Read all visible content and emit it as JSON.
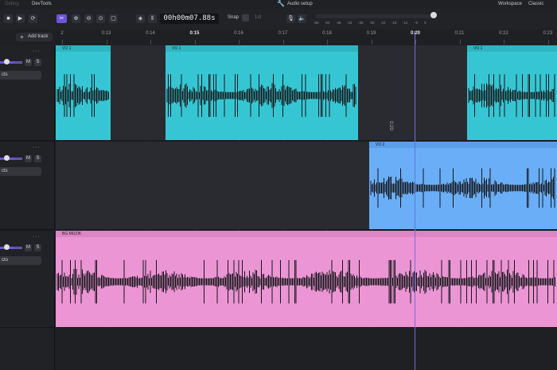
{
  "menubar": {
    "left_item": "Debug",
    "devtools": "DevTools",
    "audio_setup": "Audio setup",
    "workspace": "Workspace",
    "classic": "Classic"
  },
  "toolbar": {
    "timecode": "00h00m07.88s",
    "snap_label": "Snap",
    "snap_value": "1st",
    "db_labels": [
      "-60",
      "-54",
      "-48",
      "-42",
      "-36",
      "-30",
      "-24",
      "-18",
      "-12",
      "-6",
      "0"
    ]
  },
  "ruler": {
    "add_track": "Add track",
    "ticks": [
      {
        "label": "2",
        "pos": 0.0
      },
      {
        "label": "0:13",
        "pos": 1
      },
      {
        "label": "0:14",
        "pos": 2
      },
      {
        "label": "0:15",
        "pos": 3,
        "major": true
      },
      {
        "label": "0:16",
        "pos": 4
      },
      {
        "label": "0:17",
        "pos": 5
      },
      {
        "label": "0:18",
        "pos": 6
      },
      {
        "label": "0:19",
        "pos": 7
      },
      {
        "label": "0:20",
        "pos": 8,
        "major": true
      },
      {
        "label": "0:21",
        "pos": 9
      },
      {
        "label": "0:22",
        "pos": 10
      },
      {
        "label": "0:23",
        "pos": 11
      }
    ]
  },
  "tracks": [
    {
      "fx_label": "cts",
      "mute": "M",
      "solo": "S",
      "dots": "···"
    },
    {
      "fx_label": "cts",
      "mute": "M",
      "solo": "S",
      "dots": "···"
    },
    {
      "fx_label": "cto",
      "mute": "M",
      "solo": "S",
      "dots": "···"
    }
  ],
  "clips": [
    {
      "label": "VO 1",
      "color": "#36c6d3",
      "head": "#2fb5c2"
    },
    {
      "label": "VO 1",
      "color": "#36c6d3",
      "head": "#2fb5c2"
    },
    {
      "label": "VO 1",
      "color": "#36c6d3",
      "head": "#2fb5c2"
    },
    {
      "label": "VO 2",
      "color": "#6aaef7",
      "head": "#5a9fea"
    },
    {
      "label": "BG MUZIK",
      "color": "#ec95d4",
      "head": "#dd86c5"
    }
  ],
  "cursor_label": "0:20"
}
